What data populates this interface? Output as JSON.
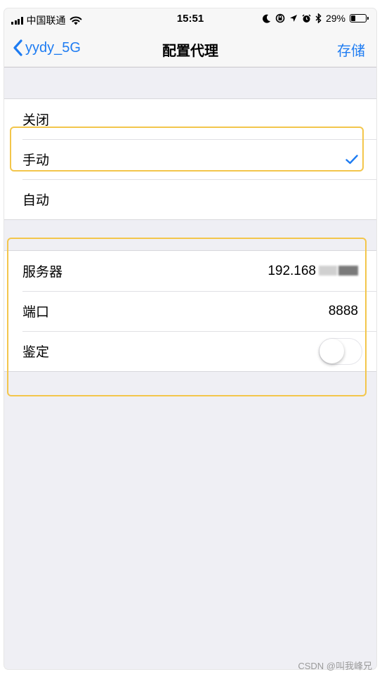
{
  "status_bar": {
    "carrier": "中国联通",
    "time": "15:51",
    "battery_percent": "29%",
    "battery_level": 0.29,
    "icons": [
      "signal-icon",
      "wifi-icon",
      "moon-icon",
      "orientation-lock-icon",
      "location-icon",
      "alarm-icon",
      "bluetooth-icon",
      "battery-icon"
    ]
  },
  "nav": {
    "back_label": "yydy_5G",
    "title": "配置代理",
    "save_label": "存储"
  },
  "proxy_modes": [
    {
      "label": "关闭",
      "selected": false
    },
    {
      "label": "手动",
      "selected": true
    },
    {
      "label": "自动",
      "selected": false
    }
  ],
  "manual_settings": {
    "server_label": "服务器",
    "server_value": "192.168",
    "port_label": "端口",
    "port_value": "8888",
    "auth_label": "鉴定",
    "auth_enabled": false
  },
  "colors": {
    "accent": "#1e7cf2",
    "highlight": "#f3c64b",
    "background": "#efeff4"
  },
  "watermark": "CSDN @叫我峰兄"
}
